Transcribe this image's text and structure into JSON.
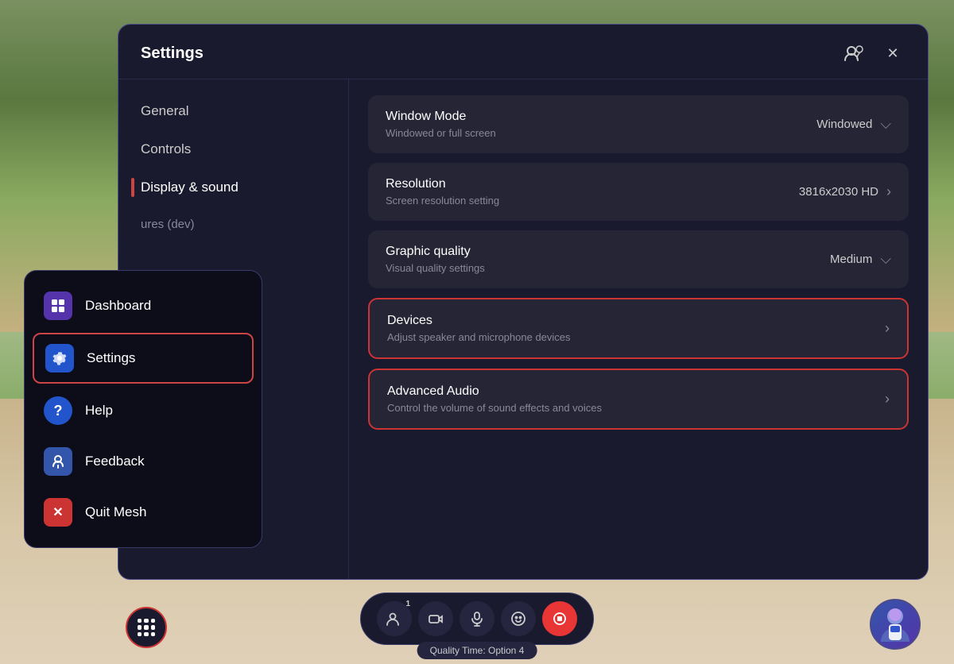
{
  "app": {
    "title": "Settings",
    "status_bar": "Quality Time: Option 4"
  },
  "sidebar": {
    "items": [
      {
        "id": "general",
        "label": "General",
        "active": false
      },
      {
        "id": "controls",
        "label": "Controls",
        "active": false
      },
      {
        "id": "display-sound",
        "label": "Display & sound",
        "active": true
      },
      {
        "id": "dev",
        "label": "ures (dev)",
        "active": false
      }
    ]
  },
  "content": {
    "rows": [
      {
        "id": "window-mode",
        "title": "Window Mode",
        "subtitle": "Windowed or full screen",
        "value": "Windowed",
        "control": "dropdown",
        "highlighted": false
      },
      {
        "id": "resolution",
        "title": "Resolution",
        "subtitle": "Screen resolution setting",
        "value": "3816x2030 HD",
        "control": "arrow",
        "highlighted": false
      },
      {
        "id": "graphic-quality",
        "title": "Graphic quality",
        "subtitle": "Visual quality settings",
        "value": "Medium",
        "control": "dropdown",
        "highlighted": false
      },
      {
        "id": "devices",
        "title": "Devices",
        "subtitle": "Adjust speaker and microphone devices",
        "value": "",
        "control": "arrow",
        "highlighted": true
      },
      {
        "id": "advanced-audio",
        "title": "Advanced Audio",
        "subtitle": "Control the volume of sound effects and voices",
        "value": "",
        "control": "arrow",
        "highlighted": true
      }
    ]
  },
  "menu": {
    "items": [
      {
        "id": "dashboard",
        "label": "Dashboard",
        "icon": "dashboard",
        "active": false
      },
      {
        "id": "settings",
        "label": "Settings",
        "icon": "settings",
        "active": true
      },
      {
        "id": "help",
        "label": "Help",
        "icon": "help",
        "active": false
      },
      {
        "id": "feedback",
        "label": "Feedback",
        "icon": "feedback",
        "active": false
      },
      {
        "id": "quit",
        "label": "Quit Mesh",
        "icon": "quit",
        "active": false
      }
    ]
  },
  "taskbar": {
    "buttons": [
      {
        "id": "people",
        "icon": "👤",
        "badge": "1"
      },
      {
        "id": "camera",
        "icon": "📷",
        "badge": ""
      },
      {
        "id": "mic",
        "icon": "🎤",
        "badge": ""
      },
      {
        "id": "emoji",
        "icon": "😊",
        "badge": ""
      },
      {
        "id": "record",
        "icon": "⏺",
        "badge": "",
        "active": true
      }
    ]
  },
  "grid_button": {
    "label": "grid"
  },
  "icons": {
    "close": "✕",
    "avatar": "🧑",
    "chevron_right": "›",
    "chevron_down": "⌄",
    "multiuser": "👥"
  }
}
